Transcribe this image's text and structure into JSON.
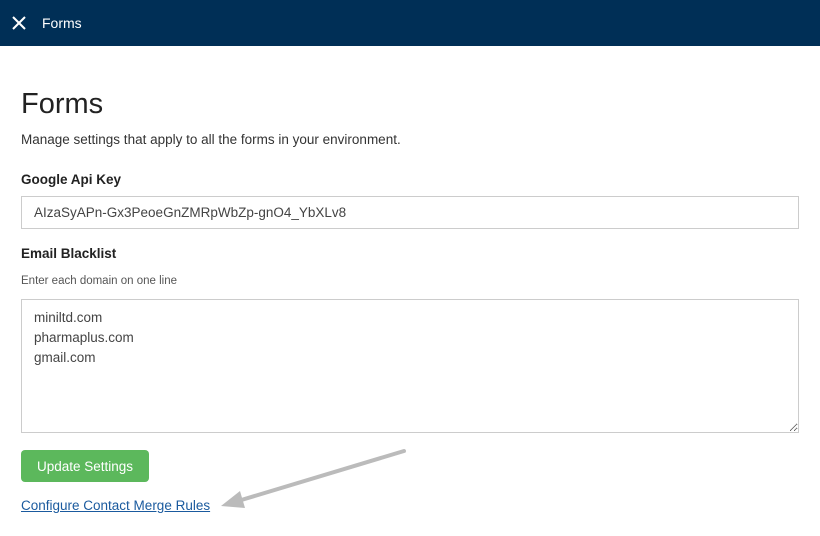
{
  "topbar": {
    "title": "Forms",
    "close_icon": "close-icon"
  },
  "page": {
    "title": "Forms",
    "description": "Manage settings that apply to all the forms in your environment."
  },
  "google_api_key": {
    "label": "Google Api Key",
    "value": "AIzaSyAPn-Gx3PeoeGnZMRpWbZp-gnO4_YbXLv8"
  },
  "email_blacklist": {
    "label": "Email Blacklist",
    "hint": "Enter each domain on one line",
    "value": "miniltd.com\npharmaplus.com\ngmail.com"
  },
  "actions": {
    "update_label": "Update Settings",
    "merge_rules_link": "Configure Contact Merge Rules"
  },
  "colors": {
    "topbar": "#002f56",
    "update_button": "#5cb85c",
    "link": "#1a5a9e",
    "annotation_arrow": "#bbbbbb"
  }
}
